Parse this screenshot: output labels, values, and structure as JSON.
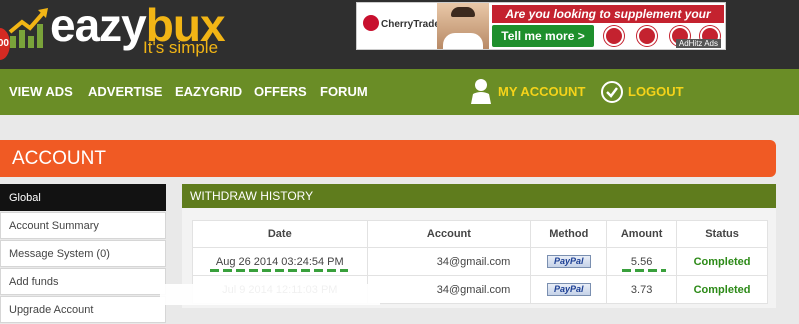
{
  "header": {
    "logo_badge": "00",
    "logo_main": "eazy",
    "logo_accent": "bux",
    "tagline": "It's simple"
  },
  "ad": {
    "brand": "CherryTrade",
    "headline": "Are you looking to supplement your Income?",
    "cta": "Tell me more >",
    "by": "AdHitz Ads"
  },
  "nav": {
    "items": [
      "VIEW ADS",
      "ADVERTISE",
      "EAZYGRID",
      "OFFERS",
      "FORUM"
    ],
    "my_account": "MY ACCOUNT",
    "logout": "LOGOUT"
  },
  "account_title": "ACCOUNT",
  "sidebar": {
    "items": [
      "Global",
      "Account Summary",
      "Message System (0)",
      "Add funds",
      "Upgrade Account"
    ]
  },
  "withdraw": {
    "title": "WITHDRAW HISTORY",
    "columns": [
      "Date",
      "Account",
      "Method",
      "Amount",
      "Status"
    ],
    "rows": [
      {
        "date": "Aug 26 2014 03:24:54 PM",
        "account": "34@gmail.com",
        "method": "PayPal",
        "amount": "5.56",
        "status": "Completed"
      },
      {
        "date": "Jul 9 2014 12:11:03 PM",
        "account": "34@gmail.com",
        "method": "PayPal",
        "amount": "3.73",
        "status": "Completed"
      }
    ]
  },
  "colors": {
    "header_bg": "#2f2f2f",
    "nav_bg": "#6a8d26",
    "accent_orange": "#f05a24",
    "brand_yellow": "#f2b515",
    "status_green": "#2c8a17"
  }
}
